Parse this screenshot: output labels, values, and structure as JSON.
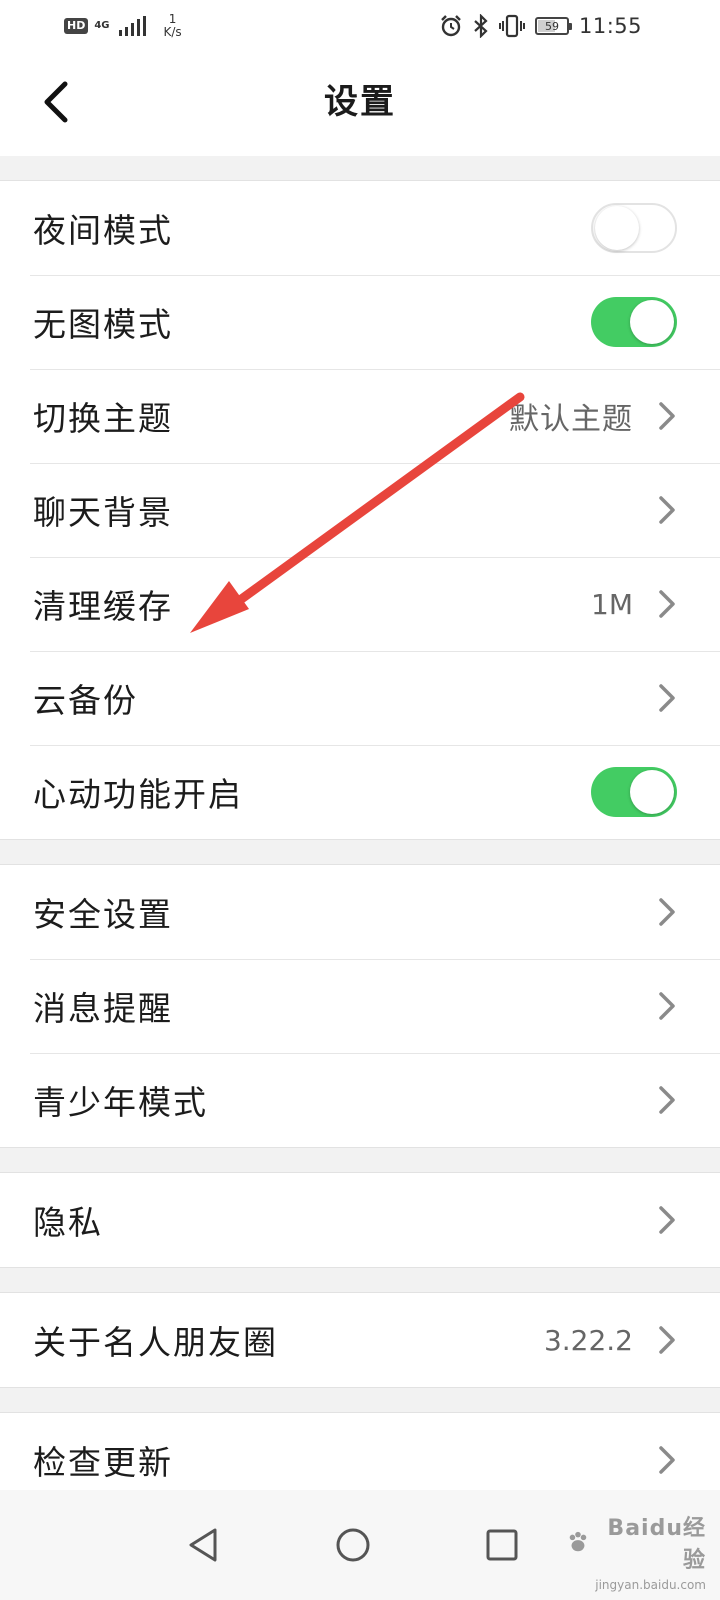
{
  "status_bar": {
    "hd_label": "HD",
    "network_generation": "4G",
    "speed_value": "1",
    "speed_unit": "K/s",
    "battery_level": "59",
    "time": "11:55"
  },
  "header": {
    "title": "设置"
  },
  "groups": [
    {
      "rows": [
        {
          "label": "夜间模式",
          "control": "toggle",
          "on": false
        },
        {
          "label": "无图模式",
          "control": "toggle",
          "on": true
        },
        {
          "label": "切换主题",
          "control": "chevron",
          "value": "默认主题"
        },
        {
          "label": "聊天背景",
          "control": "chevron",
          "value": ""
        },
        {
          "label": "清理缓存",
          "control": "chevron",
          "value": "1M"
        },
        {
          "label": "云备份",
          "control": "chevron",
          "value": ""
        },
        {
          "label": "心动功能开启",
          "control": "toggle",
          "on": true
        }
      ]
    },
    {
      "rows": [
        {
          "label": "安全设置",
          "control": "chevron",
          "value": ""
        },
        {
          "label": "消息提醒",
          "control": "chevron",
          "value": ""
        },
        {
          "label": "青少年模式",
          "control": "chevron",
          "value": ""
        }
      ]
    },
    {
      "rows": [
        {
          "label": "隐私",
          "control": "chevron",
          "value": ""
        }
      ]
    },
    {
      "rows": [
        {
          "label": "关于名人朋友圈",
          "control": "chevron",
          "value": "3.22.2"
        }
      ]
    },
    {
      "rows": [
        {
          "label": "检查更新",
          "control": "chevron",
          "value": ""
        }
      ]
    }
  ],
  "watermark": {
    "brand": "Baidu经验",
    "url": "jingyan.baidu.com"
  },
  "colors": {
    "toggle_on": "#43cc63",
    "annotation_arrow": "#e8453c",
    "page_background": "#f2f2f2"
  },
  "icons": {
    "back": "chevron-left-icon",
    "row_arrow": "chevron-right-icon",
    "nav_back": "triangle-back-icon",
    "nav_home": "circle-home-icon",
    "nav_recents": "square-recents-icon"
  }
}
